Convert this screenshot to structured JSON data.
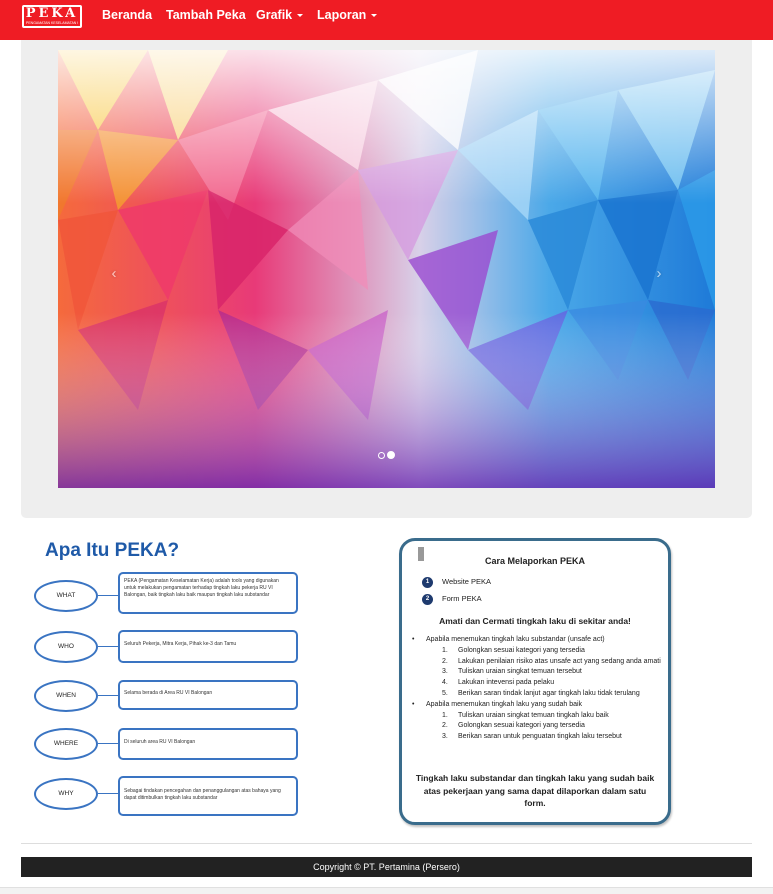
{
  "navbar": {
    "logo_text": "PEKA",
    "logo_subtext": "PENGAMATAN KESELAMATAN KERJA",
    "items": [
      {
        "label": "Beranda",
        "dropdown": false
      },
      {
        "label": "Tambah Peka",
        "dropdown": false
      },
      {
        "label": "Grafik",
        "dropdown": true
      },
      {
        "label": "Laporan",
        "dropdown": true
      }
    ],
    "accent_color": "#ef1c24"
  },
  "carousel": {
    "prev_icon": "chevron-left-icon",
    "next_icon": "chevron-right-icon",
    "prev_glyph": "‹",
    "next_glyph": "›",
    "slide_count": 2,
    "active_slide": 2
  },
  "info_left": {
    "title": "Apa Itu PEKA?",
    "rows": [
      {
        "q": "WHAT",
        "a": "PEKA (Pengamatan Keselamatan Kerja) adalah tools yang digunakan untuk melakukan pengamatan terhadap tingkah laku pekerja RU VI Balongan, baik tingkah laku baik maupun tingkah laku substandar"
      },
      {
        "q": "WHO",
        "a": "Seluruh Pekerja, Mitra Kerja, Pihak ke-3 dan Tamu"
      },
      {
        "q": "WHEN",
        "a": "Selama berada di Area RU VI Balongan"
      },
      {
        "q": "WHERE",
        "a": "Di seluruh area RU VI Balongan"
      },
      {
        "q": "WHY",
        "a": "Sebagai tindakan pencegahan dan penanggulangan atas bahaya yang dapat ditimbulkan tingkah laku substandar"
      }
    ]
  },
  "info_right": {
    "title": "Cara Melaporkan PEKA",
    "steps": [
      {
        "num": "1",
        "label": "Website PEKA"
      },
      {
        "num": "2",
        "label": "Form PEKA"
      }
    ],
    "heading": "Amati dan Cermati tingkah laku di sekitar anda!",
    "bullets": [
      {
        "text": "Apabila menemukan tingkah laku substandar (unsafe act)",
        "items": [
          "Golongkan sesuai kategori yang tersedia",
          "Lakukan penilaian risiko atas unsafe act yang sedang anda amati",
          "Tuliskan uraian singkat temuan tersebut",
          "Lakukan intevensi pada pelaku",
          "Berikan saran tindak lanjut agar tingkah laku tidak terulang"
        ]
      },
      {
        "text": "Apabila menemukan tingkah laku yang sudah baik",
        "items": [
          "Tuliskan uraian singkat temuan tingkah laku baik",
          "Golongkan sesuai kategori yang tersedia",
          "Berikan saran untuk penguatan tingkah laku tersebut"
        ]
      }
    ],
    "footer": "Tingkah laku substandar dan tingkah laku yang sudah baik atas pekerjaan yang sama dapat dilaporkan dalam satu form."
  },
  "footer": {
    "copyright": "Copyright © PT. Pertamina (Persero)"
  }
}
